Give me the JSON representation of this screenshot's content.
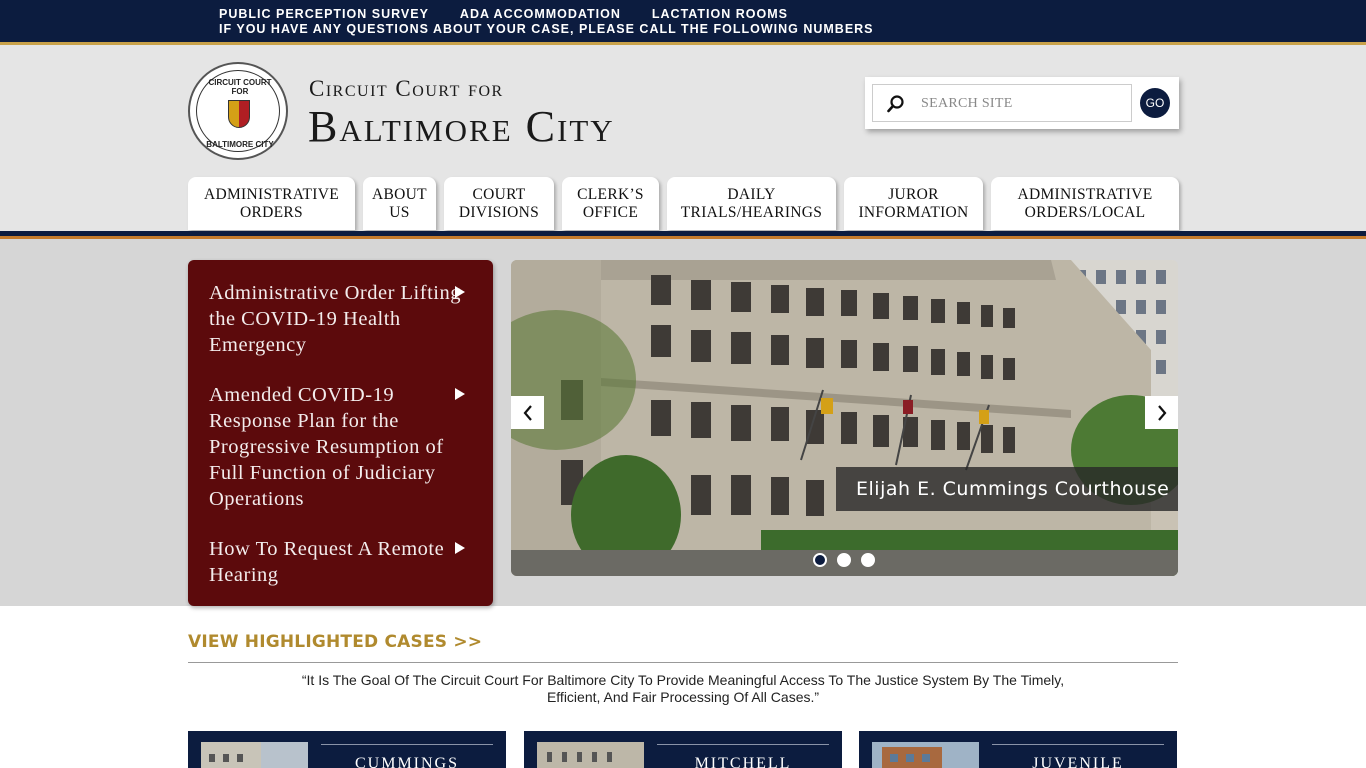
{
  "topbar": {
    "links": [
      "PUBLIC PERCEPTION SURVEY",
      "ADA ACCOMMODATION",
      "LACTATION ROOMS"
    ],
    "notice": "IF YOU HAVE ANY QUESTIONS ABOUT YOUR CASE, PLEASE CALL THE FOLLOWING NUMBERS"
  },
  "header": {
    "title_line1": "Circuit Court for",
    "title_line2": "Baltimore City",
    "seal_top": "CIRCUIT COURT FOR",
    "seal_bottom": "BALTIMORE CITY"
  },
  "search": {
    "placeholder": "SEARCH SITE",
    "go_label": "GO"
  },
  "nav": {
    "tabs": [
      {
        "label": "ADMINISTRATIVE ORDERS"
      },
      {
        "label": "ABOUT US"
      },
      {
        "label": "COURT DIVISIONS"
      },
      {
        "label": "CLERK’S OFFICE"
      },
      {
        "label": "DAILY TRIALS/HEARINGS"
      },
      {
        "label": "JUROR INFORMATION"
      },
      {
        "label": "ADMINISTRATIVE ORDERS/LOCAL"
      }
    ]
  },
  "announcements": [
    {
      "text": "Administrative Order Lifting the COVID-19 Health Emergency"
    },
    {
      "text": "Amended COVID-19 Response Plan for the Progressive Resumption of Full Function of Judiciary Operations"
    },
    {
      "text": "How To Request A Remote Hearing"
    }
  ],
  "slider": {
    "caption": "Elijah E. Cummings Courthouse",
    "slide_count": 3,
    "active_index": 0
  },
  "highlight_link": "VIEW HIGHLIGHTED CASES >>",
  "mission": "“It Is The Goal Of The Circuit Court For Baltimore City To Provide Meaningful Access To The Justice System By The Timely, Efficient, And Fair Processing Of All Cases.”",
  "cards": [
    {
      "name": "CUMMINGS"
    },
    {
      "name": "MITCHELL"
    },
    {
      "name": "JUVENILE"
    }
  ],
  "colors": {
    "navy": "#0c1c3f",
    "gold": "#c9a24a",
    "maroon": "#5c0a0c",
    "link_gold": "#b08a2e"
  }
}
